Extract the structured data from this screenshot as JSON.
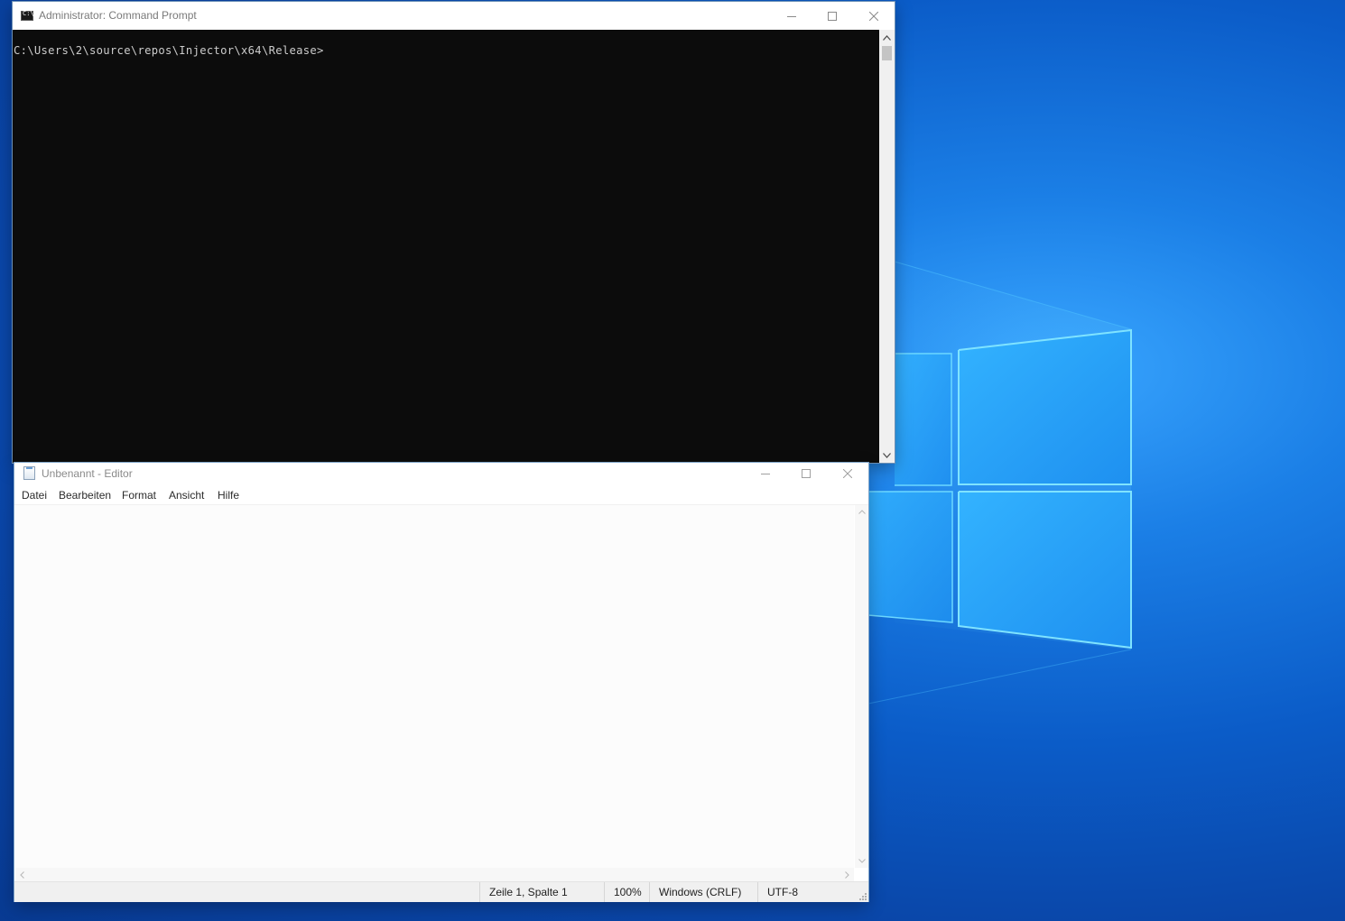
{
  "cmd_window": {
    "title": "Administrator:  Command Prompt",
    "prompt": "C:\\Users\\2\\source\\repos\\Injector\\x64\\Release>"
  },
  "notepad_window": {
    "title": "Unbenannt - Editor",
    "menu": [
      "Datei",
      "Bearbeiten",
      "Format",
      "Ansicht",
      "Hilfe"
    ],
    "status": {
      "position": "Zeile 1, Spalte 1",
      "zoom": "100%",
      "line_ending": "Windows (CRLF)",
      "encoding": "UTF-8"
    }
  },
  "icons": {
    "cmd_app": "command-prompt-icon",
    "notepad_app": "notepad-icon",
    "minimize": "minimize-icon",
    "maximize": "maximize-icon",
    "close": "close-icon"
  },
  "colors": {
    "desktop_blue": "#0b5cc8",
    "console_bg": "#0c0c0c",
    "console_text": "#cccccc",
    "logo_light": "#4fd0ff"
  }
}
